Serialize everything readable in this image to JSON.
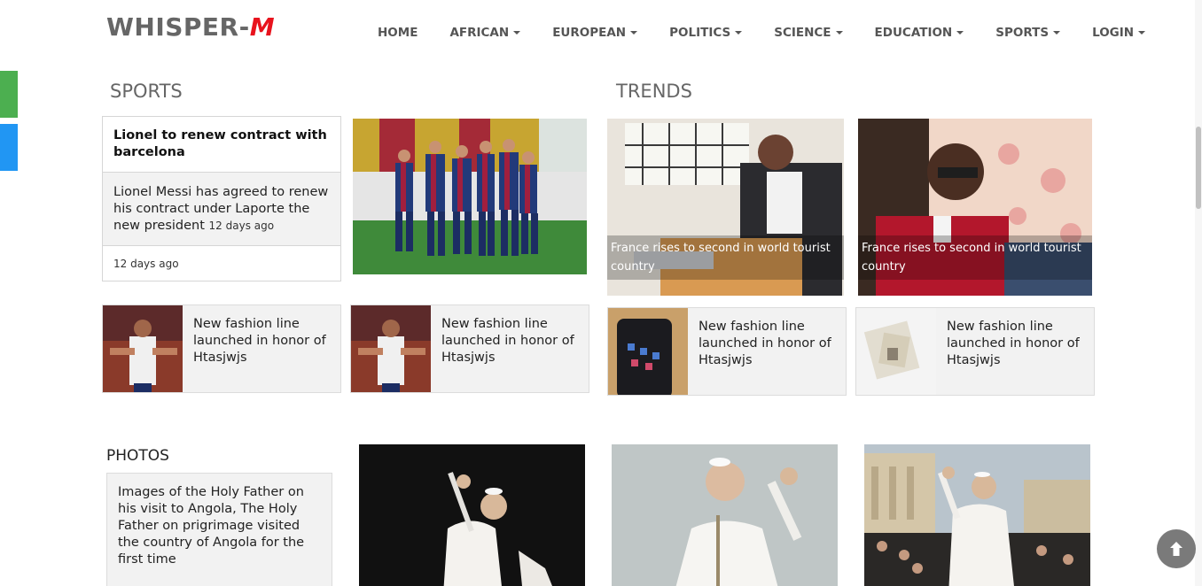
{
  "brand": {
    "name": "WHISPER-",
    "mark": "M"
  },
  "nav": [
    {
      "label": "HOME",
      "dropdown": false
    },
    {
      "label": "AFRICAN",
      "dropdown": true
    },
    {
      "label": "EUROPEAN",
      "dropdown": true
    },
    {
      "label": "POLITICS",
      "dropdown": true
    },
    {
      "label": "SCIENCE",
      "dropdown": true
    },
    {
      "label": "EDUCATION",
      "dropdown": true
    },
    {
      "label": "SPORTS",
      "dropdown": true
    },
    {
      "label": "LOGIN",
      "dropdown": true
    }
  ],
  "sports": {
    "title": "SPORTS",
    "feature": {
      "headline": "Lionel to renew contract with barcelona",
      "summary": "Lionel Messi has agreed to renew his contract under Laporte the new president",
      "summary_time": "12 days ago",
      "time": "12 days ago"
    },
    "list": [
      {
        "title": "New fashion line launched in honor of Htasjwjs"
      },
      {
        "title": "New fashion line launched in honor of Htasjwjs"
      }
    ]
  },
  "trends": {
    "title": "TRENDS",
    "cards": [
      {
        "caption": "France rises to second in world tourist country"
      },
      {
        "caption": "France rises to second in world tourist country"
      }
    ],
    "list": [
      {
        "title": "New fashion line launched in honor of Htasjwjs"
      },
      {
        "title": "New fashion line launched in honor of Htasjwjs"
      }
    ]
  },
  "photos": {
    "title": "PHOTOS",
    "description": "Images of the Holy Father on his visit to Angola, The Holy Father on prigrimage visited the country of Angola for the first time"
  },
  "icons": {
    "back_to_top": "arrow-up-icon"
  },
  "colors": {
    "brand_accent": "#e8131d",
    "side_green": "#4caf50",
    "side_blue": "#2196f3"
  }
}
